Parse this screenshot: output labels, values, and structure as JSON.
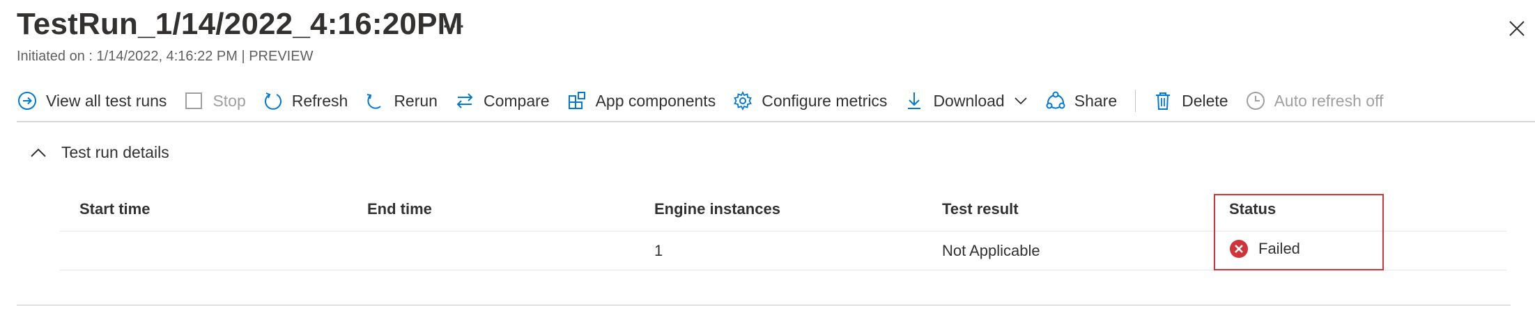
{
  "header": {
    "title": "TestRun_1/14/2022_4:16:20PM",
    "more": "···",
    "subtitle": "Initiated on : 1/14/2022, 4:16:22 PM | PREVIEW"
  },
  "toolbar": {
    "view_all": "View all test runs",
    "stop": "Stop",
    "refresh": "Refresh",
    "rerun": "Rerun",
    "compare": "Compare",
    "app_components": "App components",
    "configure_metrics": "Configure metrics",
    "download": "Download",
    "share": "Share",
    "delete": "Delete",
    "auto_refresh": "Auto refresh off"
  },
  "section": {
    "label": "Test run details"
  },
  "table": {
    "headers": {
      "start_time": "Start time",
      "end_time": "End time",
      "engine_instances": "Engine instances",
      "test_result": "Test result",
      "status": "Status"
    },
    "row": {
      "start_time": "",
      "end_time": "",
      "engine_instances": "1",
      "test_result": "Not Applicable",
      "status": "Failed"
    }
  },
  "colors": {
    "accent": "#0078d4",
    "error": "#d13438",
    "text": "#323130",
    "disabled": "#a19f9d"
  },
  "icons": {
    "view_all": "circle-arrow-right-icon",
    "stop": "checkbox-icon",
    "refresh": "refresh-icon",
    "rerun": "rerun-icon",
    "compare": "compare-arrows-icon",
    "app_components": "app-components-icon",
    "configure_metrics": "gear-icon",
    "download": "download-icon",
    "share": "share-icon",
    "delete": "trash-icon",
    "auto_refresh": "clock-icon",
    "status": "error-circle-icon",
    "close": "close-icon",
    "collapse": "chevron-up-icon"
  }
}
